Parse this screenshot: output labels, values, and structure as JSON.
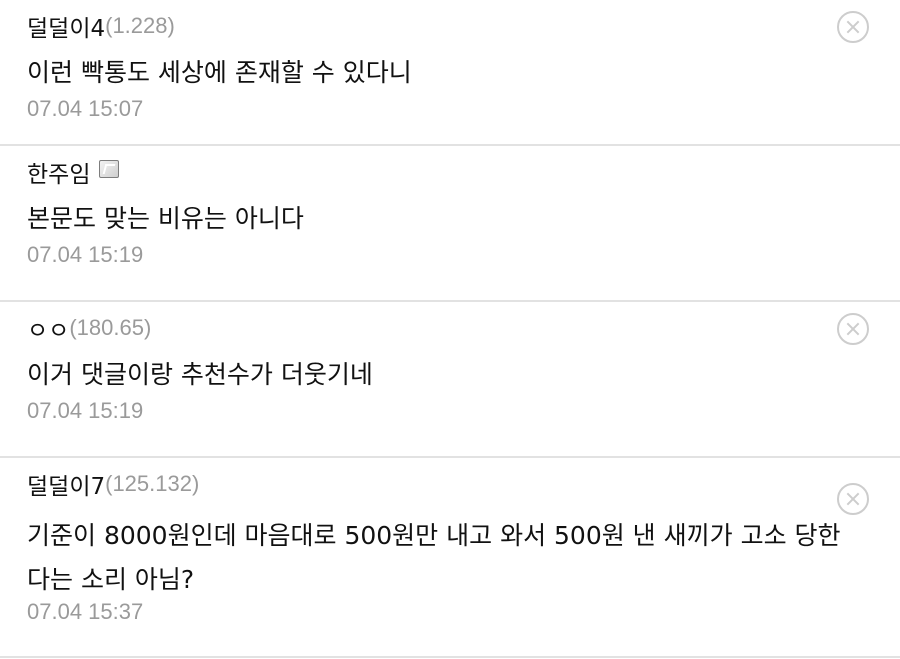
{
  "comments": [
    {
      "author": "덜덜이4",
      "ip": "(1.228)",
      "text": "이런 빡통도 세상에 존재할 수 있다니",
      "timestamp": "07.04 15:07",
      "has_delete": true
    },
    {
      "author": "한주임",
      "ip": "",
      "text": "본문도 맞는 비유는 아니다",
      "timestamp": "07.04 15:19",
      "member_icon": "member-badge-icon",
      "has_delete": false
    },
    {
      "author": "ㅇㅇ",
      "ip": "(180.65)",
      "text": "이거 댓글이랑 추천수가 더웃기네",
      "timestamp": "07.04 15:19",
      "has_delete": true
    },
    {
      "author": "덜덜이7",
      "ip": "(125.132)",
      "text": "기준이 8000원인데 마음대로 500원만 내고 와서 500원 낸 새끼가 고소 당한다는 소리 아님?",
      "timestamp": "07.04 15:37",
      "has_delete": true
    }
  ],
  "icons": {
    "delete": "close-circle-icon",
    "member": "member-badge-icon"
  },
  "colors": {
    "text": "#111111",
    "meta": "#9a9a9a",
    "divider": "#e2e2e2",
    "delete_icon": "#cdcdcd"
  }
}
